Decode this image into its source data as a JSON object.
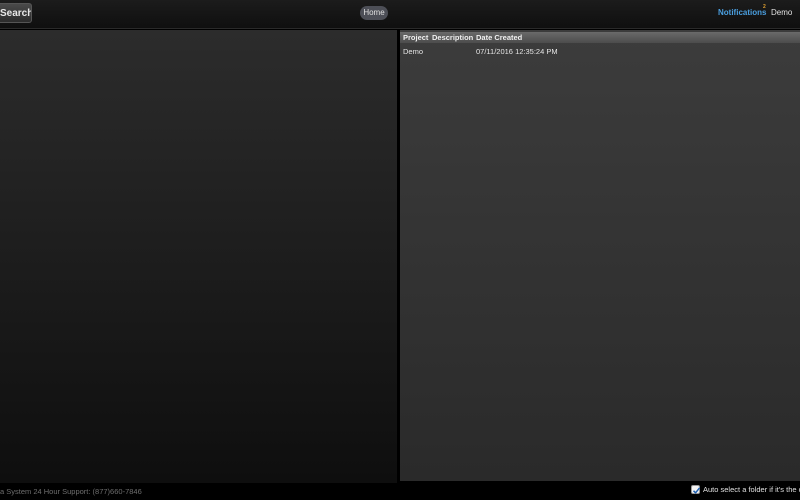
{
  "header": {
    "search_label": "Search",
    "home_label": "Home",
    "notifications_label": "Notifications",
    "notifications_count": "2",
    "user_name": "Demo"
  },
  "projects_table": {
    "columns": [
      "Project",
      "Description",
      "Date Created"
    ],
    "rows": [
      {
        "project": "Demo",
        "description": "",
        "date_created": "07/11/2016 12:35:24 PM"
      }
    ]
  },
  "footer": {
    "support_text": "a System 24 Hour Support: (877)660-7846",
    "auto_select_label": "Auto select a folder if it's the c",
    "auto_select_checked": true
  },
  "colors": {
    "notifications": "#4a9fe0",
    "badge": "#e0a030"
  }
}
